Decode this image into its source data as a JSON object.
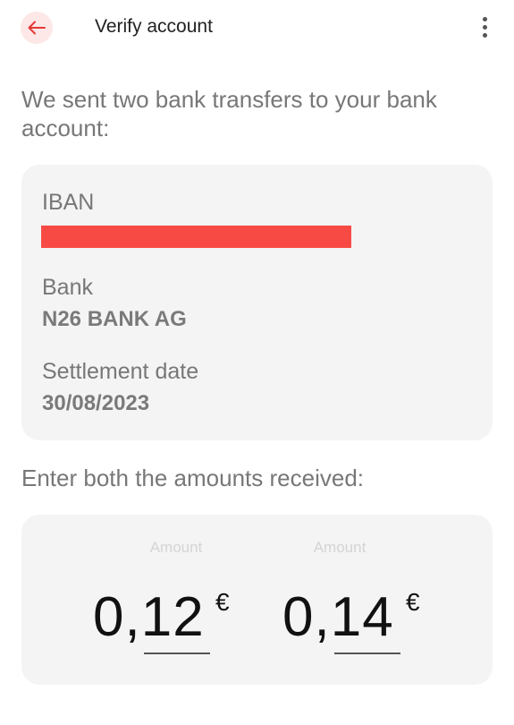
{
  "header": {
    "title": "Verify account",
    "back_icon": "arrow-left-icon",
    "menu_icon": "more-vertical-icon",
    "accent": "#e53935"
  },
  "intro": {
    "text": "We sent two bank transfers to your bank account:"
  },
  "details": {
    "iban_label": "IBAN",
    "iban_value_redacted": true,
    "redaction_color": "#f84a45",
    "bank_label": "Bank",
    "bank_value": "N26 BANK AG",
    "settlement_label": "Settlement date",
    "settlement_value": "30/08/2023"
  },
  "amounts": {
    "prompt": "Enter both the amounts received:",
    "fields": [
      {
        "label": "Amount",
        "value": "0,12",
        "currency": "€"
      },
      {
        "label": "Amount",
        "value": "0,14",
        "currency": "€"
      }
    ]
  }
}
